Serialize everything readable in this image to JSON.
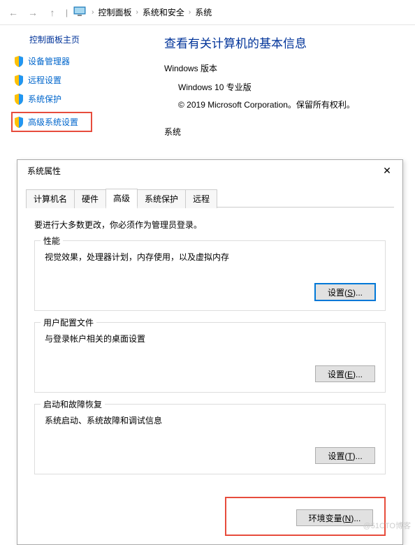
{
  "nav": {
    "crumb1": "控制面板",
    "crumb2": "系统和安全",
    "crumb3": "系统"
  },
  "sidebar": {
    "title": "控制面板主页",
    "items": [
      {
        "label": "设备管理器"
      },
      {
        "label": "远程设置"
      },
      {
        "label": "系统保护"
      },
      {
        "label": "高级系统设置"
      }
    ]
  },
  "content": {
    "title": "查看有关计算机的基本信息",
    "win_edition_label": "Windows 版本",
    "win_edition": "Windows 10 专业版",
    "copyright": "© 2019 Microsoft Corporation。保留所有权利。",
    "system_label": "系统"
  },
  "dialog": {
    "title": "系统属性",
    "tabs": {
      "computer_name": "计算机名",
      "hardware": "硬件",
      "advanced": "高级",
      "system_protection": "系统保护",
      "remote": "远程"
    },
    "admin_note": "要进行大多数更改，你必须作为管理员登录。",
    "perf": {
      "title": "性能",
      "desc": "视觉效果，处理器计划，内存使用，以及虚拟内存",
      "btn": "设置(S)..."
    },
    "profile": {
      "title": "用户配置文件",
      "desc": "与登录帐户相关的桌面设置",
      "btn": "设置(E)..."
    },
    "startup": {
      "title": "启动和故障恢复",
      "desc": "系统启动、系统故障和调试信息",
      "btn": "设置(T)..."
    },
    "env_btn": "环境变量(N)..."
  },
  "watermark": "@51CTO博客"
}
